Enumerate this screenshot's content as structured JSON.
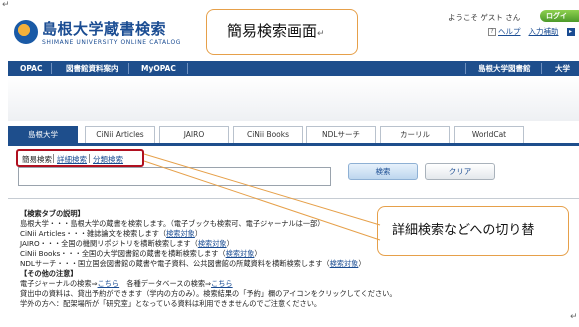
{
  "header": {
    "title": "島根大学蔵書検索",
    "subtitle": "SHIMANE UNIVERSITY ONLINE CATALOG",
    "welcome": "ようこそ ゲスト さん",
    "login": "ログイ",
    "help_mark": "?",
    "help": "ヘルプ",
    "input_help": "入力補助",
    "arrow": "▸"
  },
  "callouts": {
    "top": "簡易検索画面",
    "right": "詳細検索などへの切り替",
    "return_mark": "↵"
  },
  "navbar": {
    "items": [
      "OPAC",
      "図書館資料案内",
      "MyOPAC"
    ],
    "right_items": [
      "島根大学図書館",
      "大学"
    ]
  },
  "tabs": [
    "島根大学",
    "CiNii Articles",
    "JAIRO",
    "CiNii Books",
    "NDLサーチ",
    "カーリル",
    "WorldCat"
  ],
  "search": {
    "modes": [
      "簡易検索",
      "詳細検索",
      "分類検索"
    ],
    "query": "",
    "search_button": "検索",
    "clear_button": "クリア"
  },
  "notes": {
    "tab_heading": "【検索タブの説明】",
    "lines": [
      {
        "text": "島根大学・・・島根大学の蔵書を検索します。（電子ブックも検索可、電子ジャーナルは一部）",
        "link": ""
      },
      {
        "text": "CiNii Articles・・・雑誌論文を検索します（",
        "link": "検索対象",
        "after": "）"
      },
      {
        "text": "JAIRO・・・全国の機関リポジトリを横断検索します（",
        "link": "検索対象",
        "after": "）"
      },
      {
        "text": "CiNii Books・・・全国の大学図書館の蔵書を横断検索します（",
        "link": "検索対象",
        "after": "）"
      },
      {
        "text": "NDLサーチ・・・国立国会図書館の蔵書や電子資料、公共図書館の所蔵資料を横断検索します（",
        "link": "検索対象",
        "after": "）"
      }
    ],
    "other_heading": "【その他の注意】",
    "ej_prefix": "電子ジャーナルの検索⇒",
    "ej_link": "こちら",
    "db_prefix": "　各種データベースの検索⇒",
    "db_link": "こちら",
    "other_lines": [
      "貸出中の資料は、貸出予約ができます（学内の方のみ）。検索結果の「予約」欄のアイコンをクリックしてください。",
      "学外の方へ：配架場所が「研究室」となっている資料は利用できませんのでご注意ください。"
    ]
  }
}
